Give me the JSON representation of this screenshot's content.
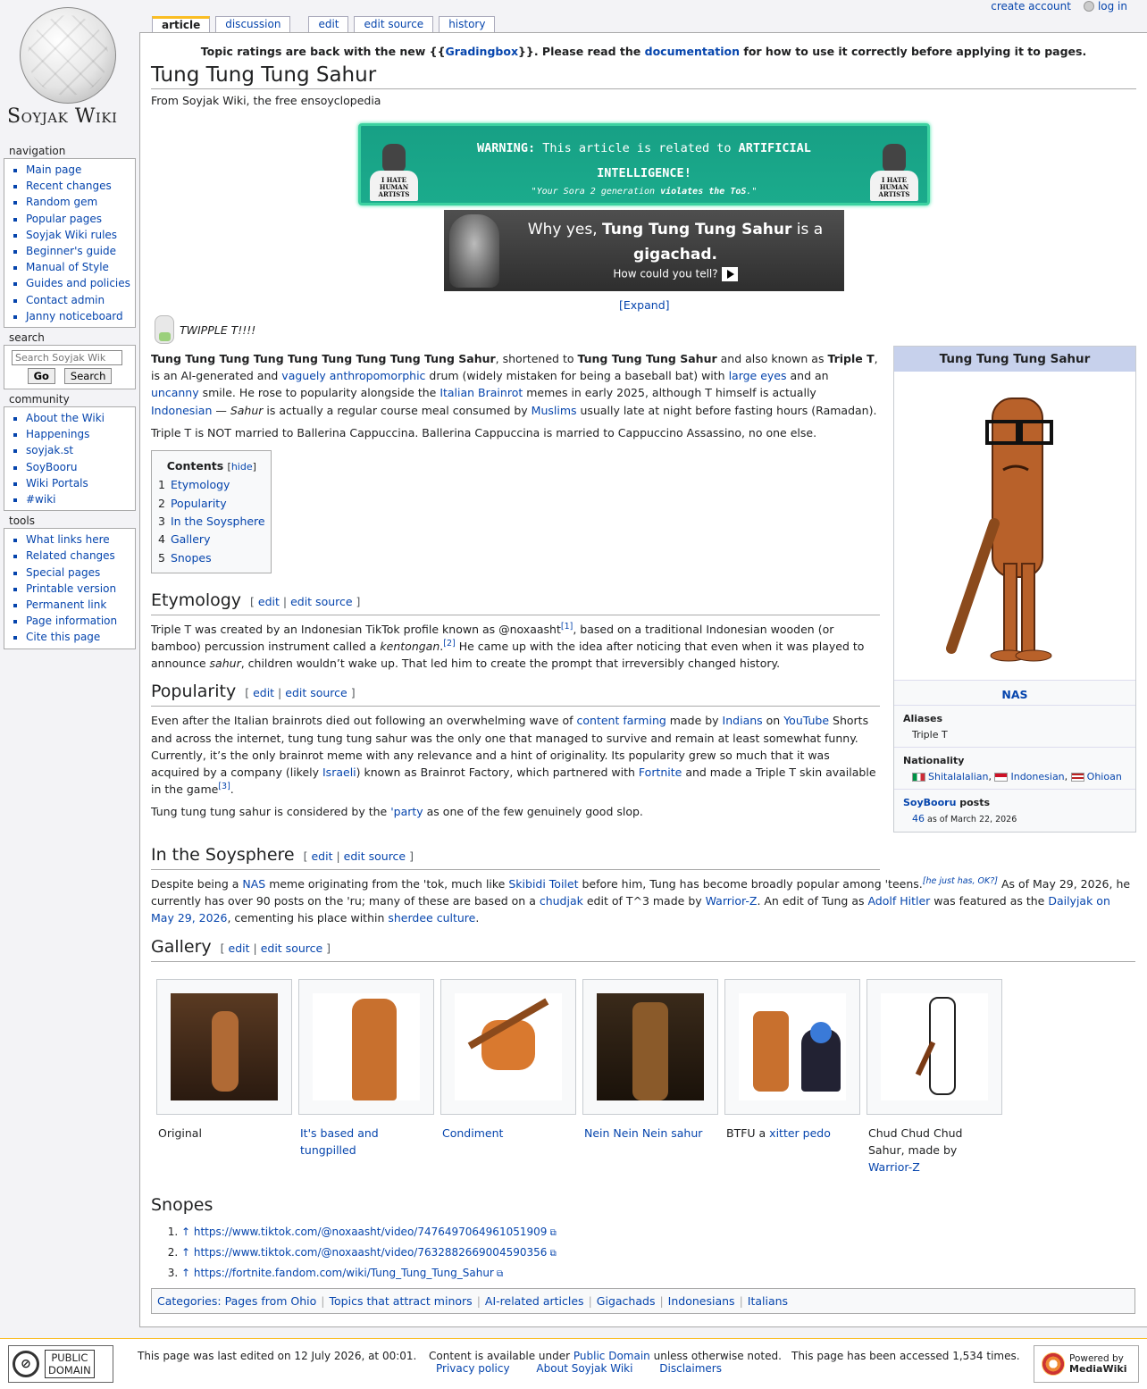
{
  "personal": {
    "create_account": "create account",
    "log_in": "log in"
  },
  "tabs": {
    "article": "article",
    "discussion": "discussion",
    "edit": "edit",
    "edit_source": "edit source",
    "history": "history"
  },
  "logo": {
    "wordmark": "Soyjak Wiki"
  },
  "nav": {
    "title": "navigation",
    "items": [
      "Main page",
      "Recent changes",
      "Random gem",
      "Popular pages",
      "Soyjak Wiki rules",
      "Beginner's guide",
      "Manual of Style",
      "Guides and policies",
      "Contact admin",
      "Janny noticeboard"
    ]
  },
  "search": {
    "title": "search",
    "placeholder": "Search Soyjak Wik",
    "go": "Go",
    "search": "Search"
  },
  "community": {
    "title": "community",
    "items": [
      "About the Wiki",
      "Happenings",
      "soyjak.st",
      "SoyBooru",
      "Wiki Portals",
      "#wiki"
    ]
  },
  "tools": {
    "title": "tools",
    "items": [
      "What links here",
      "Related changes",
      "Special pages",
      "Printable version",
      "Permanent link",
      "Page information",
      "Cite this page"
    ]
  },
  "notice": {
    "pre": "Topic ratings are back with the new {{",
    "link1": "Gradingbox",
    "mid": "}}. Please read the ",
    "link2": "documentation",
    "post": " for how to use it correctly before applying it to pages."
  },
  "page": {
    "title": "Tung Tung Tung Sahur",
    "tagline": "From Soyjak Wiki, the free ensoyclopedia"
  },
  "warning": {
    "label": "WARNING:",
    "text1": " This article is related to ",
    "bold": "ARTIFICIAL INTELLIGENCE!",
    "sub_pre": "\"Your Sora 2 generation ",
    "sub_bold": "violates the ToS",
    "sub_post": ".\"",
    "fig_text": "I HATE HUMAN ARTISTS"
  },
  "giga": {
    "pre": "Why yes, ",
    "name": "Tung Tung Tung Sahur",
    "mid": " is a ",
    "word": "gigachad.",
    "q": "How could you tell?",
    "expand": "[Expand]"
  },
  "twipple": "TWIPPLE T!!!!",
  "intro": {
    "p1": [
      {
        "t": "Tung Tung Tung Tung Tung Tung Tung Tung Tung Sahur",
        "s": "b"
      },
      {
        "t": ", shortened to "
      },
      {
        "t": "Tung Tung Tung Sahur",
        "s": "b"
      },
      {
        "t": " and also known as "
      },
      {
        "t": "Triple T",
        "s": "b"
      },
      {
        "t": ", is an AI-generated and "
      },
      {
        "t": "vaguely anthropomorphic",
        "s": "a"
      },
      {
        "t": " drum (widely mistaken for being a baseball bat) with "
      },
      {
        "t": "large eyes",
        "s": "a"
      },
      {
        "t": " and an "
      },
      {
        "t": "uncanny",
        "s": "a"
      },
      {
        "t": " smile. He rose to popularity alongside the "
      },
      {
        "t": "Italian Brainrot",
        "s": "a"
      },
      {
        "t": " memes in early 2025, although T himself is actually "
      },
      {
        "t": "Indonesian",
        "s": "a"
      },
      {
        "t": " — "
      },
      {
        "t": "Sahur",
        "s": "i"
      },
      {
        "t": " is actually a regular course meal consumed by "
      },
      {
        "t": "Muslims",
        "s": "a"
      },
      {
        "t": " usually late at night before fasting hours (Ramadan)."
      }
    ],
    "p2": "Triple T is NOT married to Ballerina Cappuccina. Ballerina Cappuccina is married to Cappuccino Assassino, no one else."
  },
  "toc": {
    "title": "Contents",
    "hide": "hide",
    "items": [
      {
        "n": "1",
        "t": "Etymology"
      },
      {
        "n": "2",
        "t": "Popularity"
      },
      {
        "n": "3",
        "t": "In the Soysphere"
      },
      {
        "n": "4",
        "t": "Gallery"
      },
      {
        "n": "5",
        "t": "Snopes"
      }
    ]
  },
  "editsec": {
    "edit": "edit",
    "edit_source": "edit source"
  },
  "sections": {
    "etymology": {
      "title": "Etymology",
      "p": [
        {
          "t": "Triple T was created by an Indonesian TikTok profile known as @noxaasht"
        },
        {
          "t": "[1]",
          "s": "sup"
        },
        {
          "t": ", based on a traditional Indonesian wooden (or bamboo) percussion instrument called a "
        },
        {
          "t": "kentongan",
          "s": "i"
        },
        {
          "t": "."
        },
        {
          "t": "[2]",
          "s": "sup"
        },
        {
          "t": " He came up with the idea after noticing that even when it was played to announce "
        },
        {
          "t": "sahur",
          "s": "i"
        },
        {
          "t": ", children wouldn’t wake up. That led him to create the prompt that irreversibly changed history."
        }
      ]
    },
    "popularity": {
      "title": "Popularity",
      "p1": [
        {
          "t": "Even after the Italian brainrots died out following an overwhelming wave of "
        },
        {
          "t": "content farming",
          "s": "a"
        },
        {
          "t": " made by "
        },
        {
          "t": "Indians",
          "s": "a"
        },
        {
          "t": " on "
        },
        {
          "t": "YouTube",
          "s": "a"
        },
        {
          "t": " Shorts and across the internet, tung tung tung sahur was the only one that managed to survive and remain at least somewhat funny. Currently, it’s the only brainrot meme with any relevance and a hint of originality. Its popularity grew so much that it was acquired by a company (likely "
        },
        {
          "t": "Israeli",
          "s": "a"
        },
        {
          "t": ") known as Brainrot Factory, which partnered with "
        },
        {
          "t": "Fortnite",
          "s": "a"
        },
        {
          "t": " and made a Triple T skin available in the game"
        },
        {
          "t": "[3]",
          "s": "sup"
        },
        {
          "t": "."
        }
      ],
      "p2": [
        {
          "t": "Tung tung tung sahur is considered by the "
        },
        {
          "t": "'party",
          "s": "a"
        },
        {
          "t": " as one of the few genuinely good slop."
        }
      ]
    },
    "soysphere": {
      "title": "In the Soysphere",
      "p": [
        {
          "t": "Despite being a "
        },
        {
          "t": "NAS",
          "s": "a"
        },
        {
          "t": " meme originating from the 'tok, much like "
        },
        {
          "t": "Skibidi Toilet",
          "s": "a"
        },
        {
          "t": " before him, Tung has become broadly popular among 'teens."
        },
        {
          "t": "[he just has, OK?]",
          "s": "supi"
        },
        {
          "t": " As of May 29, 2026, he currently has over 90 posts on the 'ru; many of these are based on a "
        },
        {
          "t": "chudjak",
          "s": "a"
        },
        {
          "t": " edit of T^3 made by "
        },
        {
          "t": "Warrior-Z",
          "s": "a"
        },
        {
          "t": ". An edit of Tung as "
        },
        {
          "t": "Adolf Hitler",
          "s": "a"
        },
        {
          "t": " was featured as the "
        },
        {
          "t": "Dailyjak on May 29, 2026",
          "s": "a"
        },
        {
          "t": ", cementing his place within "
        },
        {
          "t": "sherdee culture",
          "s": "a"
        },
        {
          "t": "."
        }
      ]
    },
    "gallery": {
      "title": "Gallery",
      "items": [
        [
          {
            "t": "Original"
          }
        ],
        [
          {
            "t": "It's based and tungpilled",
            "s": "a"
          }
        ],
        [
          {
            "t": "Condiment",
            "s": "a"
          }
        ],
        [
          {
            "t": "Nein Nein Nein sahur",
            "s": "a"
          }
        ],
        [
          {
            "t": "BTFU a "
          },
          {
            "t": "xitter pedo",
            "s": "a"
          }
        ],
        [
          {
            "t": "Chud Chud Chud Sahur, made by "
          },
          {
            "t": "Warrior-Z",
            "s": "a"
          }
        ]
      ]
    },
    "snopes": {
      "title": "Snopes",
      "refs": [
        "https://www.tiktok.com/@noxaasht/video/7476497064961051909",
        "https://www.tiktok.com/@noxaasht/video/7632882669004590356",
        "https://fortnite.fandom.com/wiki/Tung_Tung_Tung_Sahur"
      ]
    }
  },
  "categories": {
    "label": "Categories",
    "items": [
      "Pages from Ohio",
      "Topics that attract minors",
      "AI-related articles",
      "Gigachads",
      "Indonesians",
      "Italians"
    ]
  },
  "infobox": {
    "title": "Tung Tung Tung Sahur",
    "nas": "NAS",
    "aliases_label": "Aliases",
    "aliases": "Triple T",
    "nationality_label": "Nationality",
    "nationalities": [
      "Shitalalalian",
      "Indonesian",
      "Ohioan"
    ],
    "booru_link": "SoyBooru",
    "booru_posts": " posts",
    "posts_count": "46",
    "posts_date": " as of March 22, 2026"
  },
  "footer": {
    "pd_line1": "PUBLIC",
    "pd_line2": "DOMAIN",
    "last_edited": "This page was last edited on 12 July 2026, at 00:01.",
    "content_pre": "Content is available under ",
    "content_link": "Public Domain",
    "content_post": " unless otherwise noted.",
    "privacy": "Privacy policy",
    "about": "About Soyjak Wiki",
    "disclaimers": "Disclaimers",
    "accessed": "This page has been accessed 1,534 times.",
    "powered1": "Powered by",
    "powered2": "MediaWiki"
  },
  "colors": {
    "link": "#0645ad",
    "warn_bg": "#17a085",
    "infobox_header": "#c7d1ec",
    "tab_accent": "#fabd23"
  }
}
